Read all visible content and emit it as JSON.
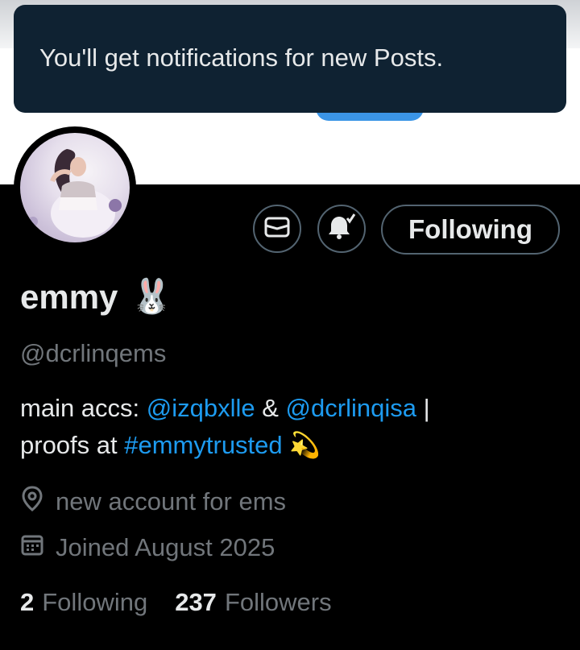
{
  "toast": {
    "message": "You'll get notifications for new Posts."
  },
  "profile": {
    "display_name": "emmy",
    "name_emoji": "🐰",
    "handle": "@dcrlinqems",
    "bio": {
      "prefix": "main accs: ",
      "mention1": "@izqbxlle",
      "amp": " & ",
      "mention2": "@dcrlinqisa",
      "pipe": " |",
      "line2_prefix": "proofs at ",
      "hashtag": "#emmytrusted",
      "emoji": " 💫"
    },
    "location": "new account for ems",
    "joined": "Joined August 2025",
    "following_count": "2",
    "following_label": "Following",
    "followers_count": "237",
    "followers_label": "Followers"
  },
  "actions": {
    "message_icon": "mail-icon",
    "notify_icon": "bell-check-icon",
    "follow_label": "Following"
  },
  "colors": {
    "background": "#000000",
    "toast_bg": "#0f2232",
    "link": "#1d9bf0",
    "primary_text": "#e7e9ea",
    "secondary_text": "#71767b",
    "border": "#536471"
  }
}
